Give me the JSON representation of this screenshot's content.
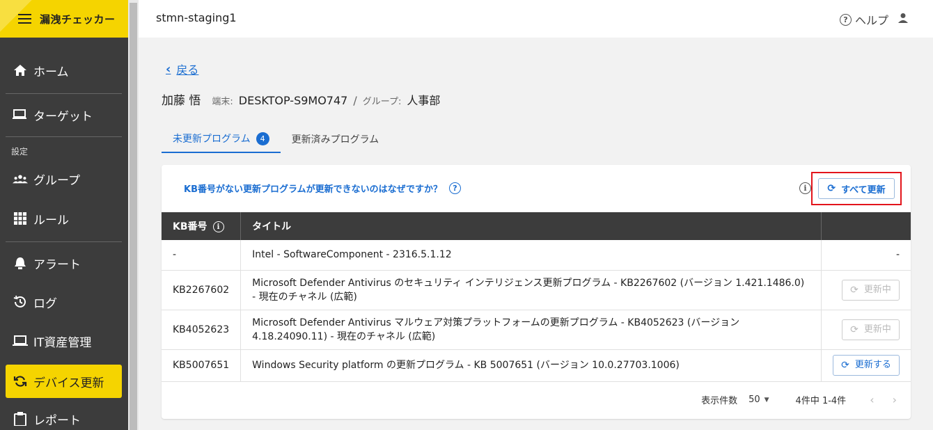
{
  "app": {
    "name": "漏洩チェッカー"
  },
  "sidebar": {
    "items": [
      {
        "label": "ホーム",
        "icon": "home-icon"
      },
      {
        "label": "ターゲット",
        "icon": "laptop-user-icon"
      }
    ],
    "section_label": "設定",
    "settings_items": [
      {
        "label": "グループ",
        "icon": "group-icon"
      },
      {
        "label": "ルール",
        "icon": "grid-icon"
      }
    ],
    "ops_items": [
      {
        "label": "アラート",
        "icon": "alarm-bell-icon"
      },
      {
        "label": "ログ",
        "icon": "history-icon"
      },
      {
        "label": "IT資産管理",
        "icon": "laptop-icon"
      },
      {
        "label": "デバイス更新",
        "icon": "sync-icon",
        "active": true
      },
      {
        "label": "レポート",
        "icon": "clipboard-icon"
      }
    ]
  },
  "header": {
    "site": "stmn-staging1",
    "help_label": "ヘルプ"
  },
  "back_label": "戻る",
  "person": {
    "name": "加藤 悟",
    "device_label": "端末:",
    "device": "DESKTOP-S9MO747",
    "separator": "/",
    "group_label": "グループ:",
    "group": "人事部"
  },
  "tabs": [
    {
      "label": "未更新プログラム",
      "badge": "4",
      "active": true
    },
    {
      "label": "更新済みプログラム"
    }
  ],
  "card": {
    "why_link": "KB番号がない更新プログラムが更新できないのはなぜですか？",
    "update_all_label": "すべて更新",
    "columns": {
      "kb": "KB番号",
      "title": "タイトル",
      "action": ""
    },
    "rows": [
      {
        "kb": "-",
        "title": "Intel - SoftwareComponent - 2316.5.1.12",
        "action_text": "-"
      },
      {
        "kb": "KB2267602",
        "title": "Microsoft Defender Antivirus のセキュリティ インテリジェンス更新プログラム - KB2267602 (バージョン 1.421.1486.0) - 現在のチャネル (広範)",
        "action_label": "更新中",
        "state": "disabled"
      },
      {
        "kb": "KB4052623",
        "title": "Microsoft Defender Antivirus マルウェア対策プラットフォームの更新プログラム - KB4052623 (バージョン 4.18.24090.11) - 現在のチャネル (広範)",
        "action_label": "更新中",
        "state": "disabled"
      },
      {
        "kb": "KB5007651",
        "title": "Windows Security platform の更新プログラム - KB 5007651 (バージョン 10.0.27703.1006)",
        "action_label": "更新する",
        "state": "enabled"
      }
    ],
    "footer": {
      "per_page_label": "表示件数",
      "per_page_value": "50",
      "range": "4件中 1-4件"
    }
  },
  "colors": {
    "accent": "#1a6dd1",
    "brand": "#f5d400",
    "sidebar": "#3c3c3c",
    "highlight": "#e3141b"
  }
}
